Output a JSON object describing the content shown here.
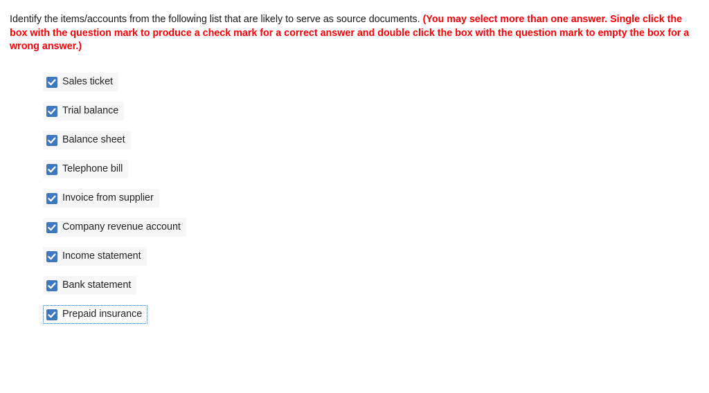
{
  "prompt": {
    "lead_text": "Identify the items/accounts from the following list that are likely to serve as source documents. ",
    "note_text": "(You may select more than one answer. Single click the box with the question mark to produce a check mark for a correct answer and double click the box with the question mark to empty the box for a wrong answer.)",
    "lead_color": "#1a1a1a",
    "note_color": "#fb0007"
  },
  "colors": {
    "checkbox_fill": "#3e77bd",
    "checkmark": "#ffffff",
    "row_background": "#f7f7f7",
    "focus_border": "#2c6ebd",
    "page_background": "#ffffff"
  },
  "options": [
    {
      "label": "Sales ticket",
      "checked": true,
      "check_icon": "check-icon",
      "focused": false
    },
    {
      "label": "Trial balance",
      "checked": true,
      "check_icon": "check-icon",
      "focused": false
    },
    {
      "label": "Balance sheet",
      "checked": true,
      "check_icon": "check-icon",
      "focused": false
    },
    {
      "label": "Telephone bill",
      "checked": true,
      "check_icon": "check-icon",
      "focused": false
    },
    {
      "label": "Invoice from supplier",
      "checked": true,
      "check_icon": "check-icon",
      "focused": false
    },
    {
      "label": "Company revenue account",
      "checked": true,
      "check_icon": "check-icon",
      "focused": false
    },
    {
      "label": "Income statement",
      "checked": true,
      "check_icon": "check-icon",
      "focused": false
    },
    {
      "label": "Bank statement",
      "checked": true,
      "check_icon": "check-icon",
      "focused": false
    },
    {
      "label": "Prepaid insurance",
      "checked": true,
      "check_icon": "check-icon",
      "focused": true
    }
  ]
}
